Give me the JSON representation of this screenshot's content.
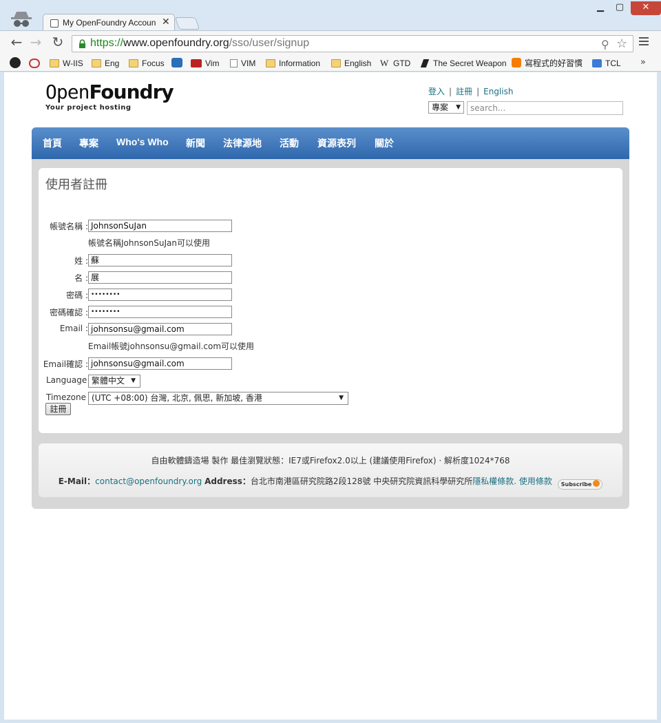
{
  "browser": {
    "tab_title": "My OpenFoundry Accoun",
    "url_scheme": "https://",
    "url_host": "www.openfoundry.org",
    "url_path": "/sso/user/signup",
    "bookmarks": [
      {
        "label": "",
        "icon": "github-icon"
      },
      {
        "label": "",
        "icon": "wsd-icon"
      },
      {
        "label": "W-IIS",
        "icon": "folder-icon"
      },
      {
        "label": "Eng",
        "icon": "folder-icon"
      },
      {
        "label": "Focus",
        "icon": "folder-icon"
      },
      {
        "label": "",
        "icon": "app-icon"
      },
      {
        "label": "Vim",
        "icon": "vim-icon"
      },
      {
        "label": "VIM",
        "icon": "page-icon"
      },
      {
        "label": "Information",
        "icon": "folder-icon"
      },
      {
        "label": "English",
        "icon": "folder-icon"
      },
      {
        "label": "GTD",
        "icon": "wikipedia-icon"
      },
      {
        "label": "The Secret Weapon",
        "icon": "feather-icon"
      },
      {
        "label": "寫程式的好習慣",
        "icon": "blogger-icon"
      },
      {
        "label": "TCL",
        "icon": "doc-icon"
      }
    ],
    "more_label": "»"
  },
  "header": {
    "logo_open": "Open",
    "logo_foundry": "Foundry",
    "logo_tagline": "Your project hosting",
    "login_label": "登入",
    "register_label": "註冊",
    "english_label": "English",
    "separator": "|",
    "search_scope": "專案",
    "search_placeholder": "search..."
  },
  "nav": {
    "items": [
      "首頁",
      "專案",
      "Who's Who",
      "新聞",
      "法律源地",
      "活動",
      "資源表列",
      "關於"
    ]
  },
  "form": {
    "title": "使用者註冊",
    "username_label": "帳號名稱 :",
    "username_value": "JohnsonSuJan",
    "username_hint": "帳號名稱JohnsonSuJan可以使用",
    "lastname_label": "姓 :",
    "lastname_value": "蘇",
    "firstname_label": "名 :",
    "firstname_value": "展",
    "password_label": "密碼 :",
    "password_value": "••••••••",
    "password_confirm_label": "密碼確認 :",
    "password_confirm_value": "••••••••",
    "email_label": "Email :",
    "email_value": "johnsonsu@gmail.com",
    "email_hint": "Email帳號johnsonsu@gmail.com可以使用",
    "email_confirm_label": "Email確認 :",
    "email_confirm_value": "johnsonsu@gmail.com",
    "language_label": "Language :",
    "language_value": "繁體中文",
    "timezone_label": "Timezone :",
    "timezone_value": "(UTC +08:00) 台灣, 北京, 佩思, 新加坡, 香港",
    "submit_label": "註冊"
  },
  "footer": {
    "line1": "自由軟體鑄造場 製作 最佳瀏覽狀態：IE7或Firefox2.0以上 (建議使用Firefox) · 解析度1024*768",
    "email_label": "E-Mail：",
    "email": "contact@openfoundry.org",
    "address_label": "Address：",
    "address": "台北市南港區研究院路2段128號 中央研究院資訊科學研究所",
    "privacy": "隱私權條款.",
    "terms": "使用條款",
    "subscribe": "Subscribe"
  }
}
